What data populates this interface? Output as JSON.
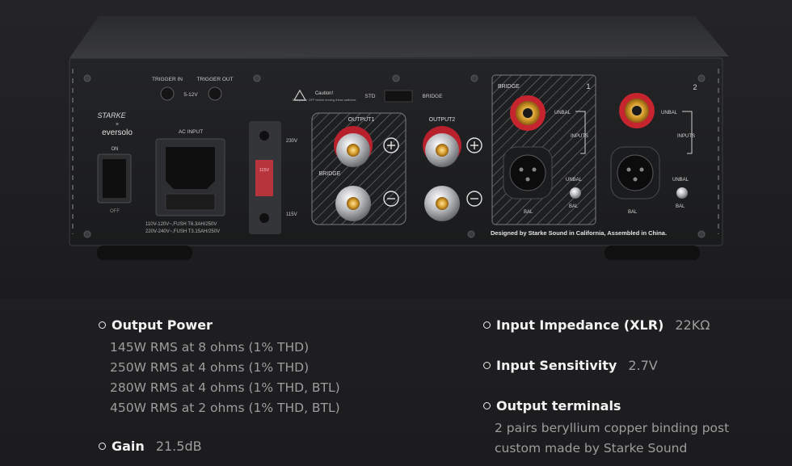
{
  "panel": {
    "trigger_in": "TRIGGER IN",
    "trigger_out": "TRIGGER OUT",
    "trigger_voltage": "5-12V",
    "brand_top": "STARKE",
    "brand_x": "×",
    "brand_bottom": "eversolo",
    "power_on": "ON",
    "power_off": "OFF",
    "ac_input": "AC INPUT",
    "fuse_110": "110V-120V~,FUSH T6.3AH/250V",
    "fuse_220": "220V-240V~,FUSH T3.15AH/250V",
    "caution_title": "Caution!",
    "caution_text": "Turn power OFF before moving these switches",
    "std": "STD",
    "bridge_switch": "BRIDGE",
    "v230": "230V",
    "v115": "115V",
    "switch_label": "115V",
    "output1": "OUTPUT1",
    "output2": "OUTPUT2",
    "bridge_label": "BRIDGE",
    "input_bridge": "BRIDGE",
    "ch1": "1",
    "ch2": "2",
    "unbal": "UNBAL",
    "inputs": "INPUTS",
    "bal": "BAL",
    "designed": "Designed by Starke Sound in California, Assembled in China."
  },
  "specs": {
    "output_power": {
      "title": "Output Power",
      "lines": [
        "145W RMS at 8 ohms (1% THD)",
        "250W RMS at 4 ohms (1% THD)",
        "280W RMS at 4 ohms (1% THD, BTL)",
        "450W RMS at 2 ohms (1% THD, BTL)"
      ]
    },
    "gain": {
      "title": "Gain",
      "value": "21.5dB"
    },
    "input_impedance": {
      "title": "Input Impedance (XLR)",
      "value": "22KΩ"
    },
    "input_sensitivity": {
      "title": "Input Sensitivity",
      "value": "2.7V"
    },
    "output_terminals": {
      "title": "Output terminals",
      "lines": [
        "2 pairs beryllium copper binding post",
        "custom made by Starke Sound"
      ]
    }
  }
}
